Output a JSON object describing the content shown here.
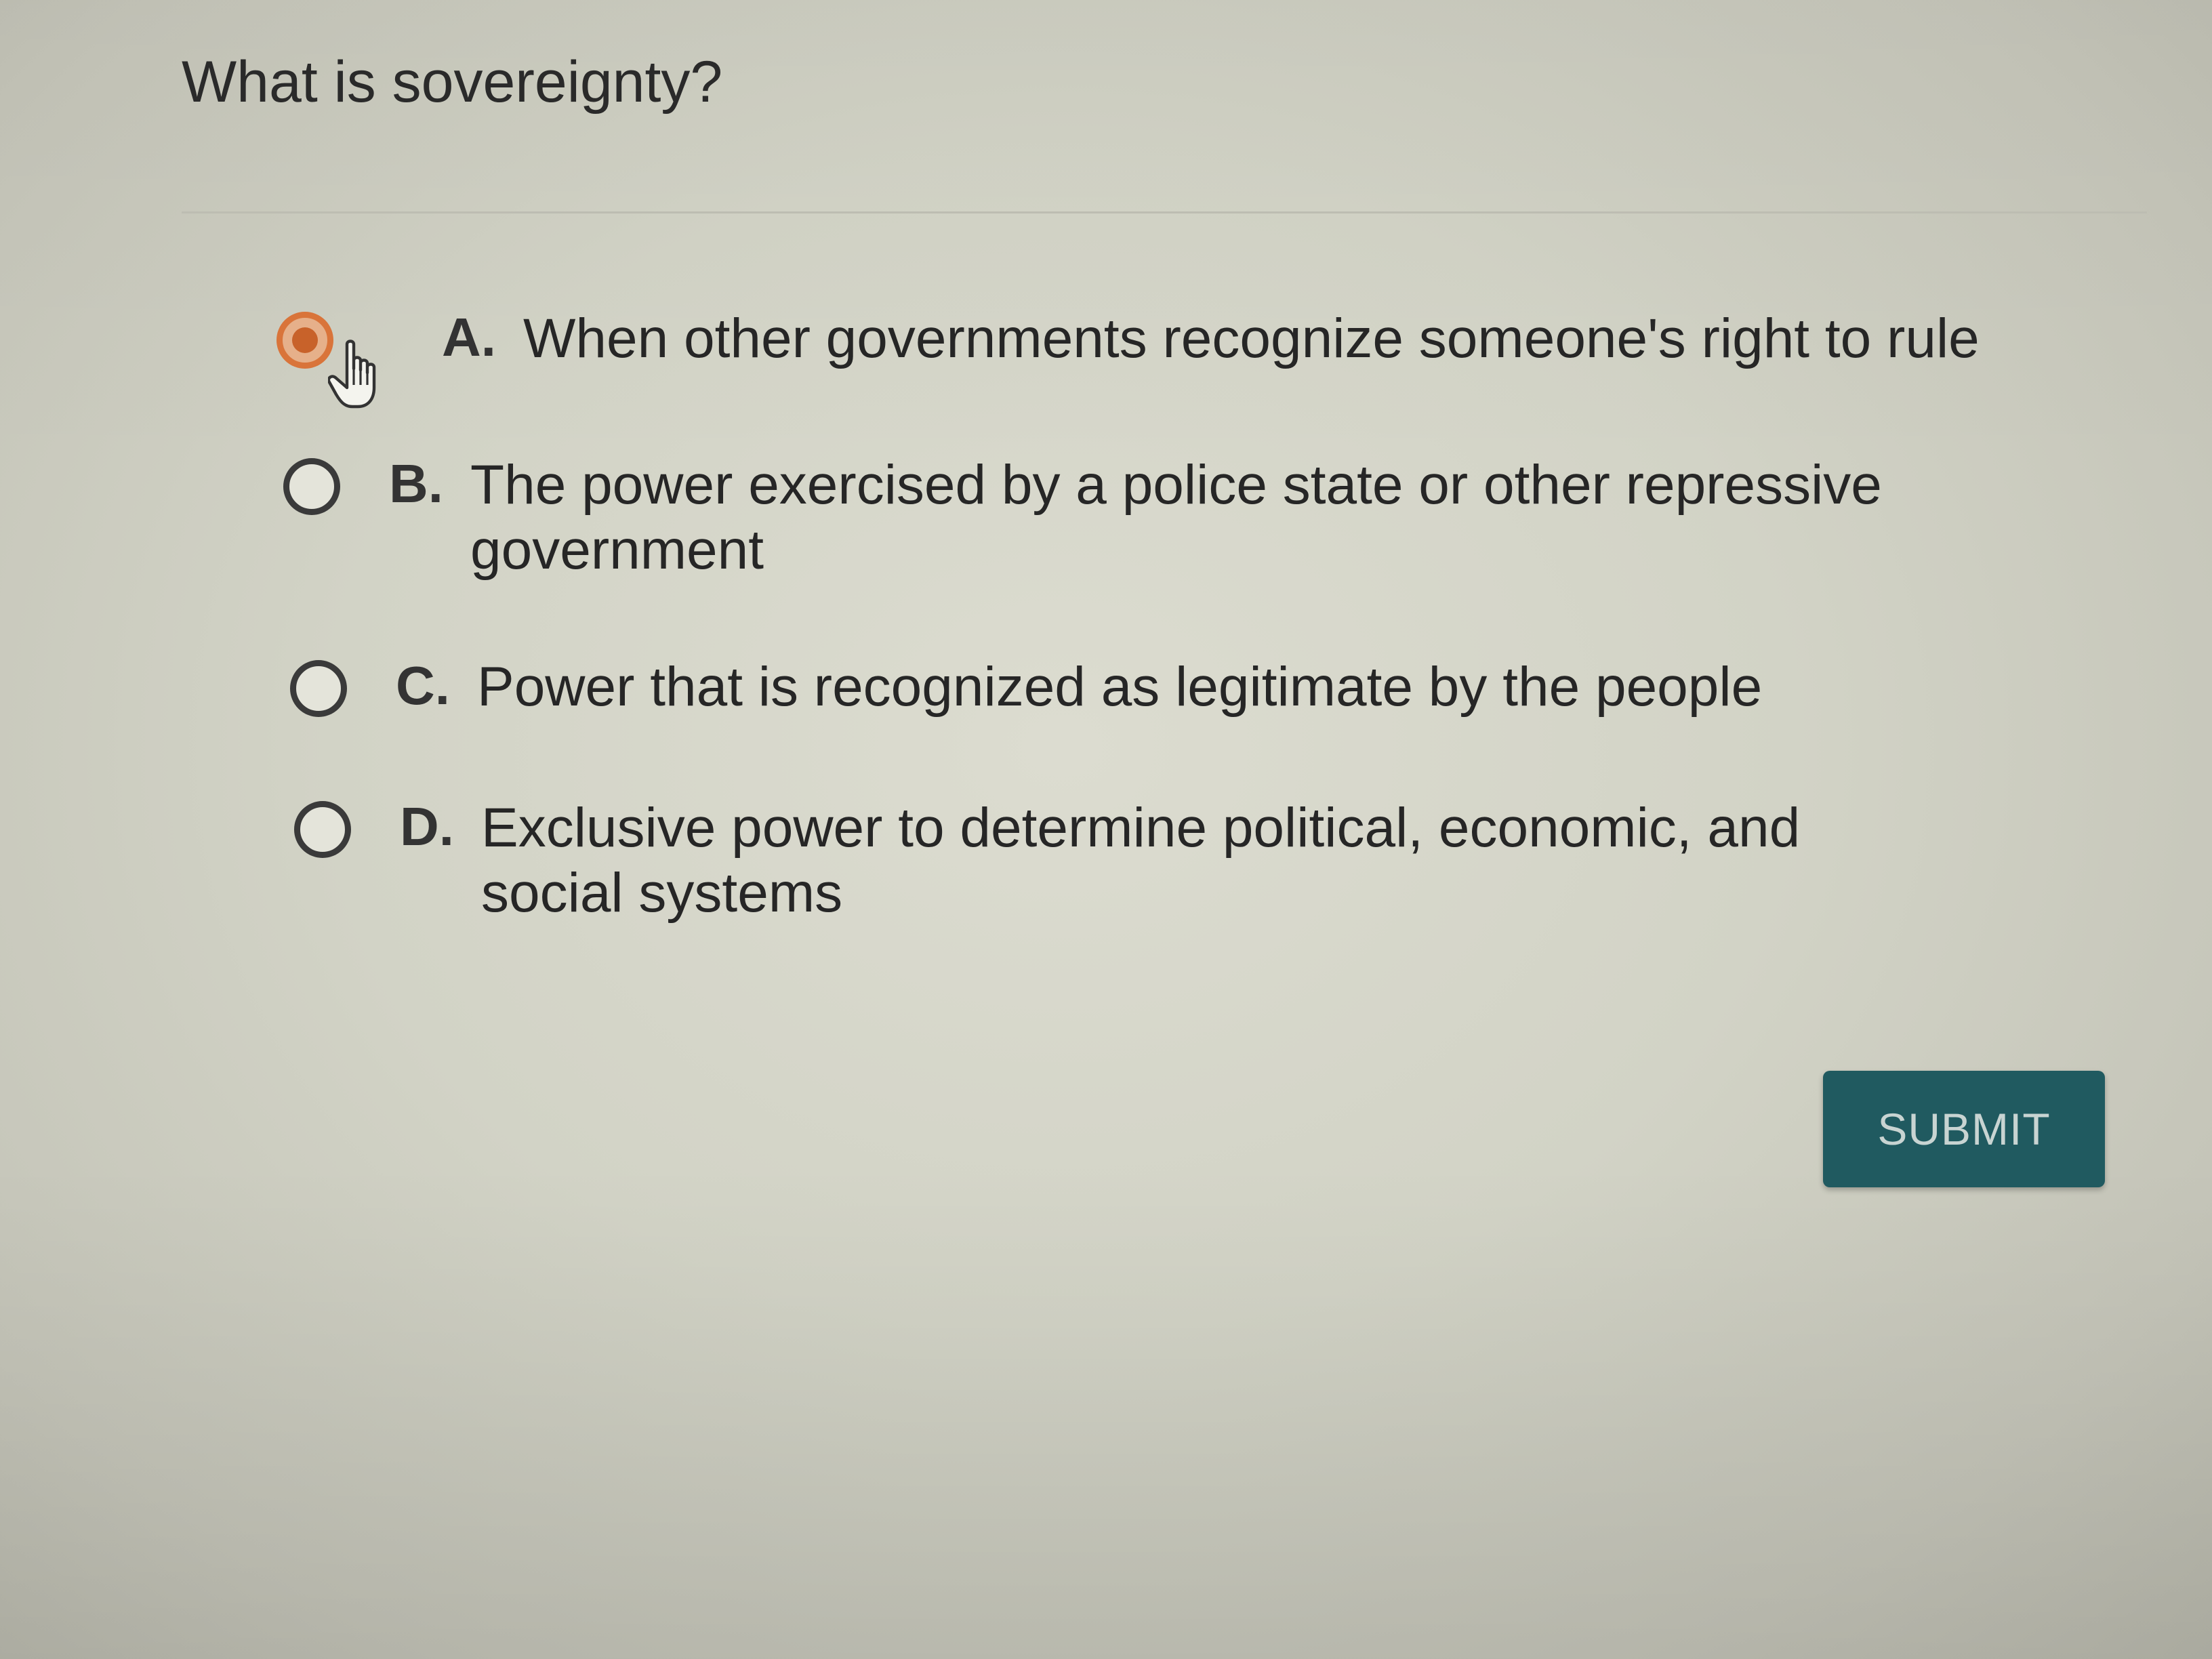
{
  "question": {
    "text": "What is sovereignty?"
  },
  "options": [
    {
      "letter": "A.",
      "text": "When other governments recognize someone's right to rule",
      "selected": true
    },
    {
      "letter": "B.",
      "text": "The power exercised by a police state or other repressive government",
      "selected": false
    },
    {
      "letter": "C.",
      "text": "Power that is recognized as legitimate by the people",
      "selected": false
    },
    {
      "letter": "D.",
      "text": "Exclusive power to determine political, economic, and social systems",
      "selected": false
    }
  ],
  "submit": {
    "label": "SUBMIT"
  },
  "colors": {
    "accent_selected": "#d9743a",
    "submit_background": "#205a60"
  },
  "icons": {
    "cursor": "hand-pointer-icon"
  }
}
